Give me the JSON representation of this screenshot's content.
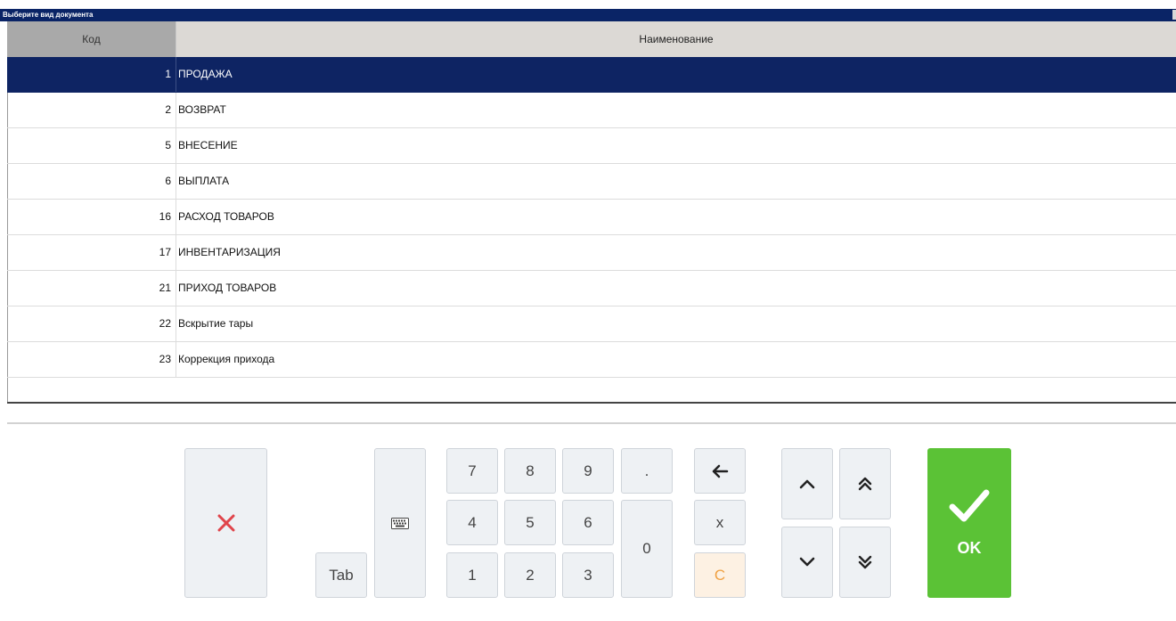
{
  "window": {
    "title": "Выберите вид документа"
  },
  "table": {
    "columns": [
      "Код",
      "Наименование"
    ],
    "rows": [
      {
        "code": "1",
        "name": "ПРОДАЖА"
      },
      {
        "code": "2",
        "name": "ВОЗВРАТ"
      },
      {
        "code": "5",
        "name": "ВНЕСЕНИЕ"
      },
      {
        "code": "6",
        "name": "ВЫПЛАТА"
      },
      {
        "code": "16",
        "name": "РАСХОД ТОВАРОВ"
      },
      {
        "code": "17",
        "name": "ИНВЕНТАРИЗАЦИЯ"
      },
      {
        "code": "21",
        "name": "ПРИХОД ТОВАРОВ"
      },
      {
        "code": "22",
        "name": "Вскрытие тары"
      },
      {
        "code": "23",
        "name": "Коррекция прихода"
      }
    ]
  },
  "keypad": {
    "tab": "Tab",
    "d7": "7",
    "d8": "8",
    "d9": "9",
    "dot": ".",
    "d4": "4",
    "d5": "5",
    "d6": "6",
    "d1": "1",
    "d2": "2",
    "d3": "3",
    "d0": "0",
    "x": "x",
    "c": "C",
    "ok": "OK"
  },
  "icons": {
    "cancel": "close-icon",
    "keyboard": "keyboard-icon",
    "backspace": "arrow-left-icon",
    "up": "chevron-up-icon",
    "page_up": "double-chevron-up-icon",
    "down": "chevron-down-icon",
    "page_down": "double-chevron-down-icon",
    "ok": "check-icon"
  },
  "colors": {
    "titlebar": "#0a2466",
    "selected_row": "#0e2463",
    "ok_button": "#5bc236",
    "cancel_icon": "#e0454b",
    "clear_text": "#f0a142"
  }
}
